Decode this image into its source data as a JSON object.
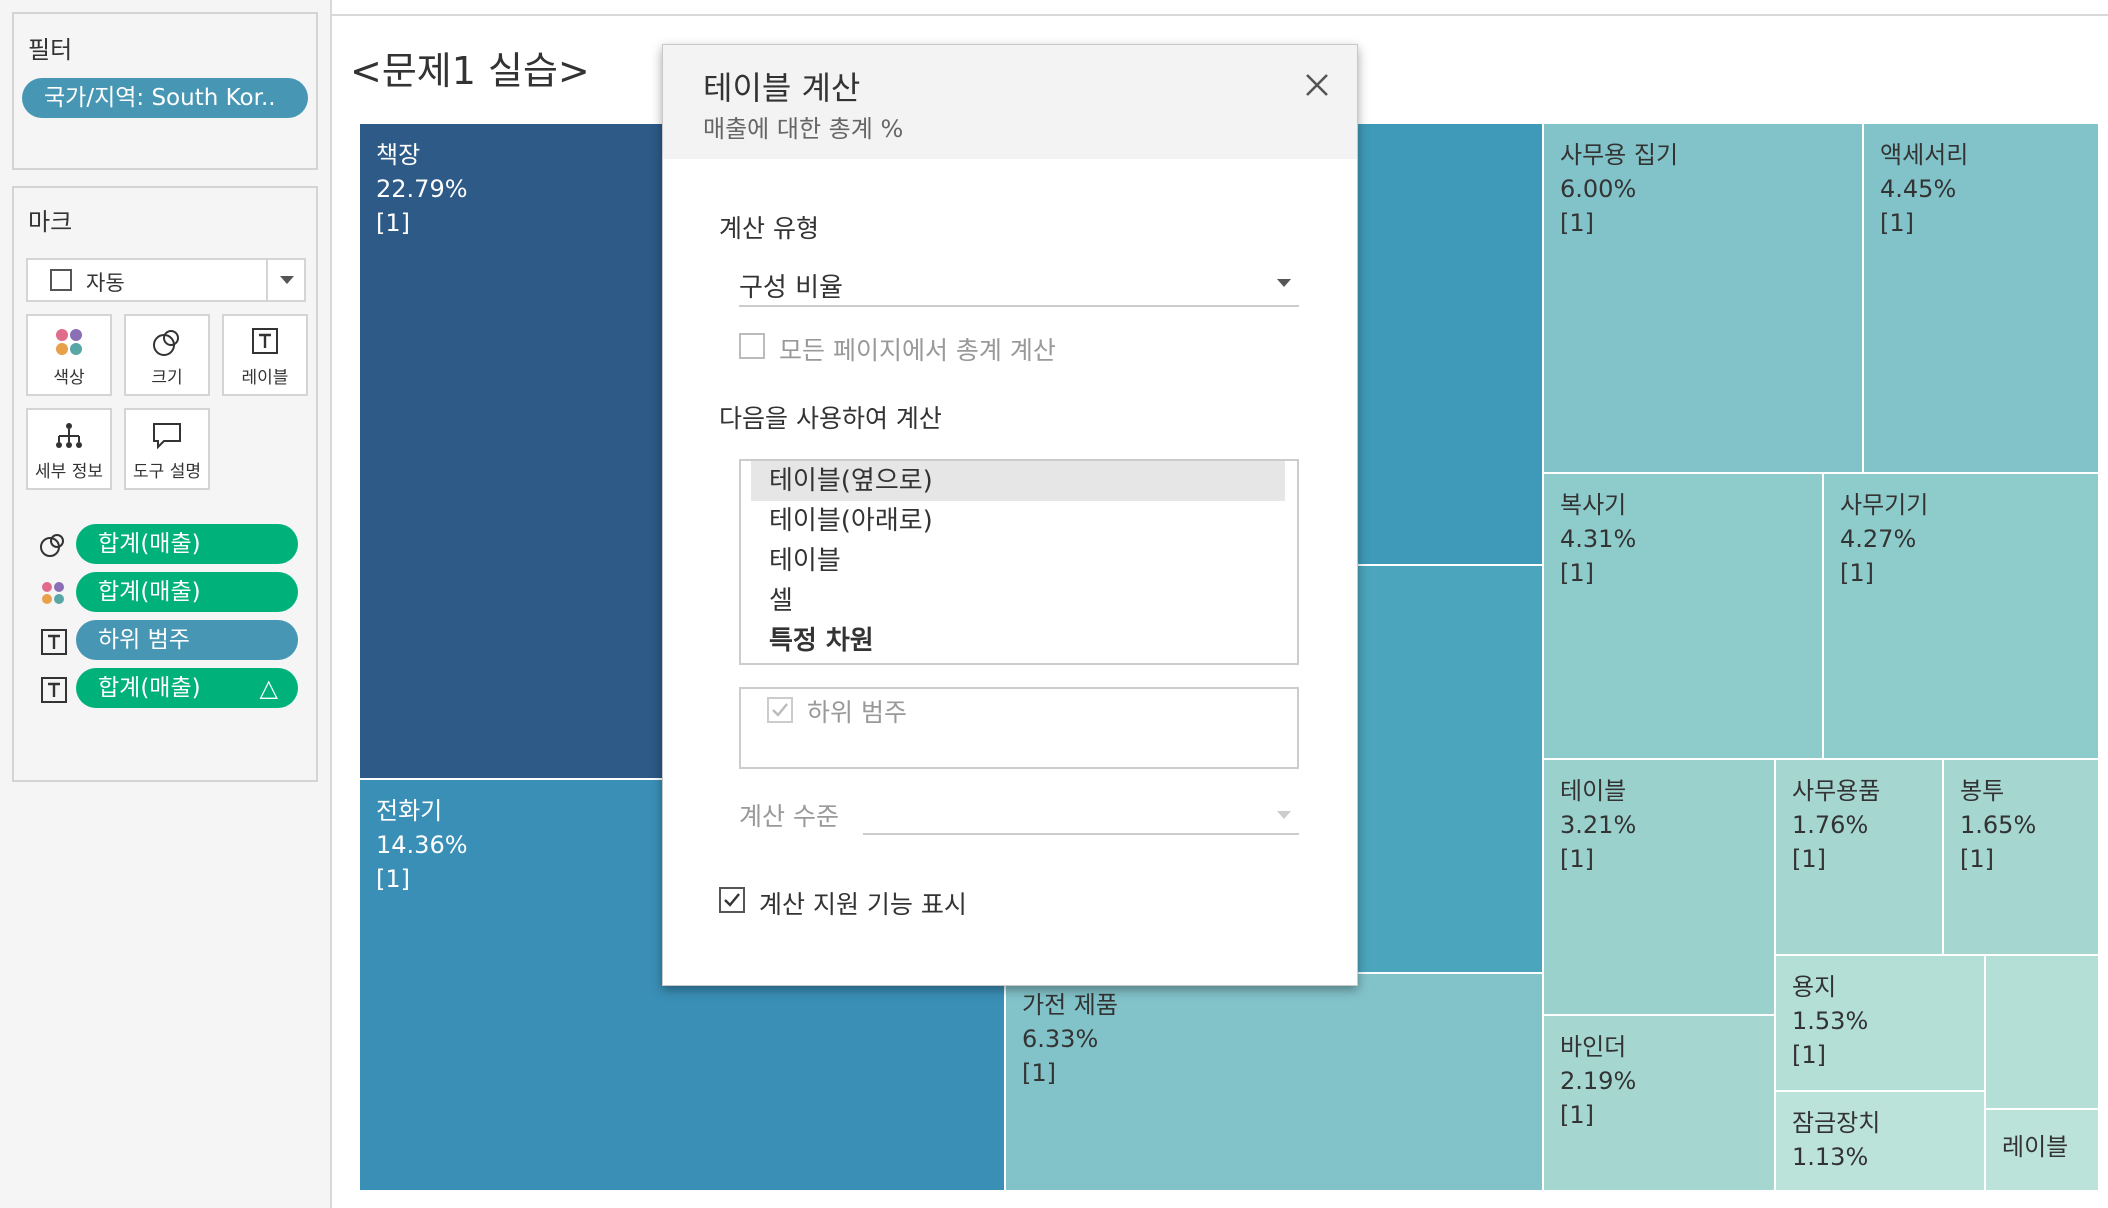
{
  "sidebar": {
    "filter_title": "필터",
    "filter_pill": "국가/지역: South Kor..",
    "marks_title": "마크",
    "mark_type": "자동",
    "mark_buttons": {
      "color": "색상",
      "size": "크기",
      "label": "레이블",
      "detail": "세부 정보",
      "tooltip": "도구 설명"
    },
    "mark_fields": [
      {
        "label": "합계(매출)",
        "kind": "size"
      },
      {
        "label": "합계(매출)",
        "kind": "color"
      },
      {
        "label": "하위 범주",
        "kind": "label"
      },
      {
        "label": "합계(매출)",
        "kind": "label",
        "badge": "△"
      }
    ]
  },
  "sheet": {
    "title": "<문제1 실습>"
  },
  "treemap": {
    "tiles": [
      {
        "name": "책장",
        "pct": "22.79%",
        "rank": "[1]"
      },
      {
        "name": "전화기",
        "pct": "14.36%",
        "rank": "[1]"
      },
      {
        "name": "사무용 집기",
        "pct": "6.00%",
        "rank": "[1]"
      },
      {
        "name": "액세서리",
        "pct": "4.45%",
        "rank": "[1]"
      },
      {
        "name": "복사기",
        "pct": "4.31%",
        "rank": "[1]"
      },
      {
        "name": "사무기기",
        "pct": "4.27%",
        "rank": "[1]"
      },
      {
        "name": "테이블",
        "pct": "3.21%",
        "rank": "[1]"
      },
      {
        "name": "사무용품",
        "pct": "1.76%",
        "rank": "[1]"
      },
      {
        "name": "봉투",
        "pct": "1.65%",
        "rank": "[1]"
      },
      {
        "name": "가전 제품",
        "pct": "6.33%",
        "rank": "[1]"
      },
      {
        "name": "바인더",
        "pct": "2.19%",
        "rank": "[1]"
      },
      {
        "name": "용지",
        "pct": "1.53%",
        "rank": "[1]"
      },
      {
        "name": "잠금장치",
        "pct": "1.13%",
        "rank": ""
      },
      {
        "name": "레이블",
        "pct": "",
        "rank": ""
      }
    ]
  },
  "dialog": {
    "title": "테이블 계산",
    "subtitle": "매출에 대한 총계 %",
    "calc_type_label": "계산 유형",
    "calc_type_value": "구성 비율",
    "all_pages_label": "모든 페이지에서 총계 계산",
    "compute_using_label": "다음을 사용하여 계산",
    "compute_options": [
      "테이블(옆으로)",
      "테이블(아래로)",
      "테이블",
      "셀",
      "특정 차원"
    ],
    "selected_option": "테이블(옆으로)",
    "dimension_label": "하위 범주",
    "level_label": "계산 수준",
    "show_assist_label": "계산 지원 기능 표시"
  },
  "colors": {
    "dark_blue": "#2d5a86",
    "mid_blue": "#3a8fb7",
    "teal": "#4aa5bd",
    "light_teal": "#82c3ca",
    "pale_teal": "#9bd1cd",
    "palest_teal": "#b3dfd6",
    "green_pill": "#00b27a",
    "blue_pill": "#4796b3"
  }
}
